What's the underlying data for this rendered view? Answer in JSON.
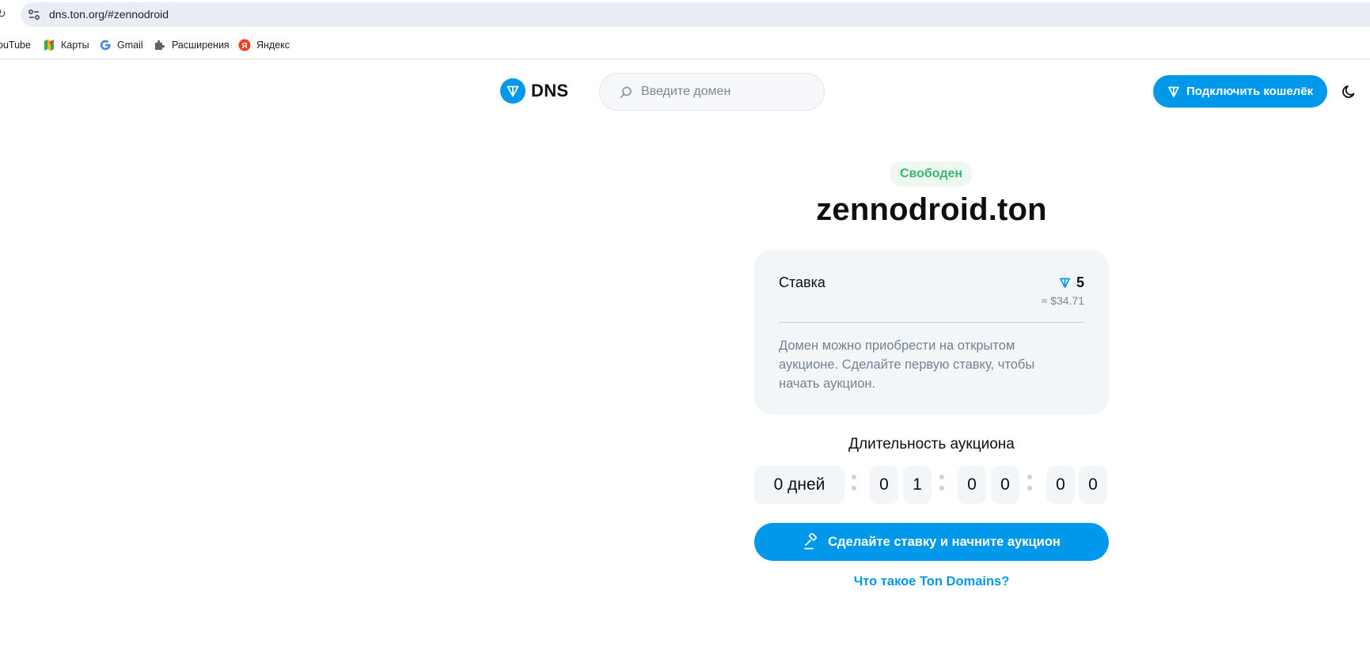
{
  "browser": {
    "url": "dns.ton.org/#zennodroid",
    "bookmarks": [
      {
        "label": "ouTube",
        "icon": "youtube-icon"
      },
      {
        "label": "Карты",
        "icon": "maps-icon"
      },
      {
        "label": "Gmail",
        "icon": "google-icon"
      },
      {
        "label": "Расширения",
        "icon": "puzzle-icon"
      },
      {
        "label": "Яндекс",
        "icon": "yandex-icon"
      }
    ]
  },
  "header": {
    "logo_text": "DNS",
    "search_placeholder": "Введите домен",
    "connect_label": "Подключить кошелёк"
  },
  "domain": {
    "status": "Свободен",
    "name": "zennodroid.ton"
  },
  "bid": {
    "label": "Ставка",
    "amount": "5",
    "usd": "≈ $34.71",
    "description": "Домен можно приобрести на открытом аукционе. Сделайте первую ставку, чтобы начать аукцион."
  },
  "auction": {
    "duration_label": "Длительность аукциона",
    "days": "0 дней",
    "hours": [
      "0",
      "1"
    ],
    "minutes": [
      "0",
      "0"
    ],
    "seconds": [
      "0",
      "0"
    ]
  },
  "cta_label": "Сделайте ставку и начните аукцион",
  "what_link": "Что такое Ton Domains?",
  "colors": {
    "accent": "#0098ea",
    "success": "#36b96a",
    "card_bg": "#f3f6f9"
  }
}
